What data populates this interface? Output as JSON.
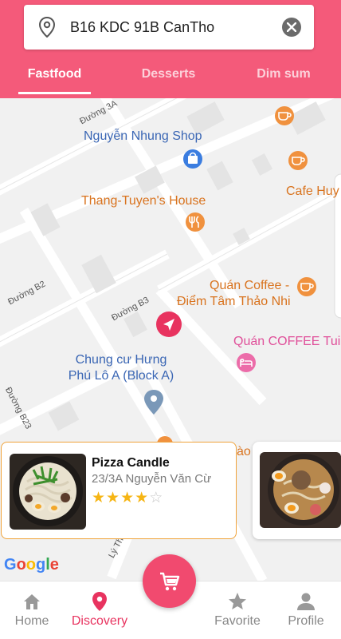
{
  "search": {
    "value": "B16 KDC 91B CanTho"
  },
  "tabs": [
    {
      "label": "Fastfood",
      "active": true
    },
    {
      "label": "Desserts",
      "active": false
    },
    {
      "label": "Dim sum",
      "active": false
    }
  ],
  "map": {
    "places": [
      {
        "name": "Nguyễn Nhung Shop",
        "category": "shop-icon"
      },
      {
        "name": "Thang-Tuyen's House",
        "category": "restaurant-icon"
      },
      {
        "name": "Cafe Huy",
        "category": "cafe-icon"
      },
      {
        "name": "Quán Coffee -",
        "name2": "Điểm Tâm Thảo Nhi",
        "category": "cafe-icon"
      },
      {
        "name": "Quán COFFEE Tui",
        "category": "hotel-icon"
      },
      {
        "name": "Chung cư Hưng",
        "name2": "Phú Lô A (Block A)",
        "category": "pin-icon"
      },
      {
        "name": "ào",
        "category": "restaurant-icon"
      }
    ],
    "streets": [
      "Đường 3A",
      "Đường B2",
      "Đường B3",
      "Đường B23",
      "Lý Thái"
    ],
    "attribution": [
      "G",
      "o",
      "o",
      "g",
      "l",
      "e"
    ]
  },
  "cards": [
    {
      "name": "Pizza Candle",
      "address": "23/3A Nguyễn Văn Cừ",
      "rating": 4,
      "max_rating": 5
    }
  ],
  "bottom_nav": [
    {
      "label": "Home",
      "icon": "home-icon",
      "active": false
    },
    {
      "label": "Discovery",
      "icon": "location-pin-icon",
      "active": true
    },
    {
      "label": "Favorite",
      "icon": "star-icon",
      "active": false
    },
    {
      "label": "Profile",
      "icon": "person-icon",
      "active": false
    }
  ],
  "fab": {
    "icon": "cart-icon"
  },
  "colors": {
    "primary": "#f45a7a",
    "accent_pink": "#e8335f",
    "card_border": "#f0a33a",
    "star": "#f6b514"
  }
}
